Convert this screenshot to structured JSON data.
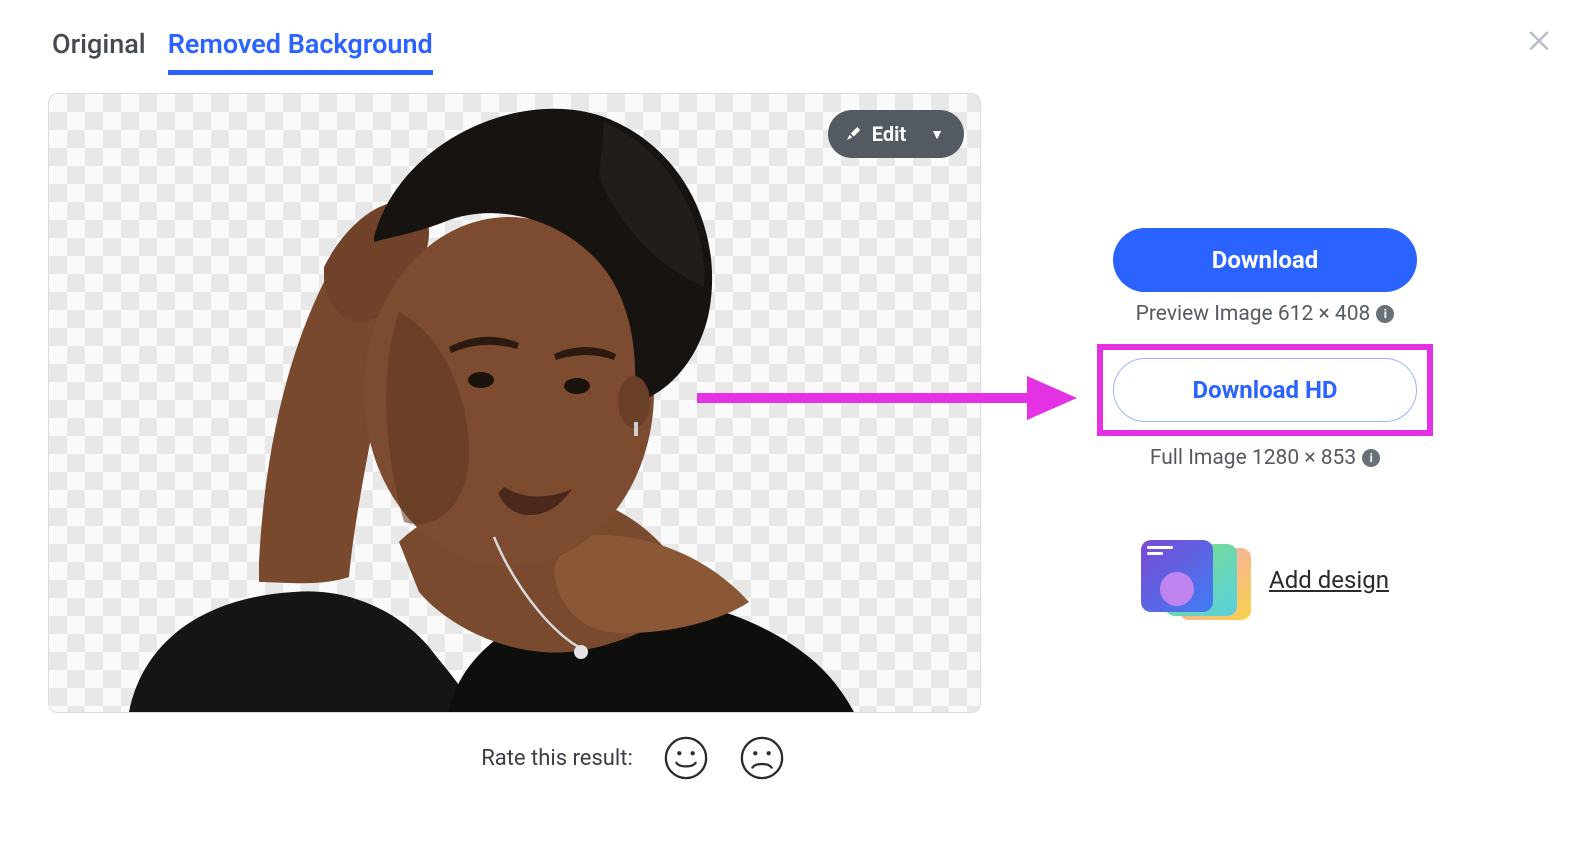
{
  "tabs": {
    "original": "Original",
    "removed": "Removed Background"
  },
  "edit_button": {
    "label": "Edit"
  },
  "rating": {
    "label": "Rate this result:"
  },
  "download": {
    "primary_label": "Download",
    "preview_caption": "Preview Image 612 × 408",
    "hd_label": "Download HD",
    "full_caption": "Full Image 1280 × 853"
  },
  "design": {
    "link_label": "Add design"
  },
  "annotation": {
    "highlight_color": "#e431e4"
  }
}
